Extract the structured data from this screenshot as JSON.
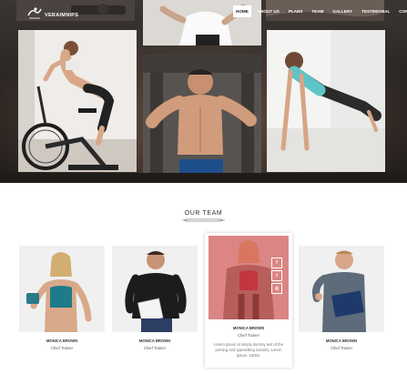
{
  "nav": {
    "logo_text": "VERAIMNIPS",
    "menu": [
      {
        "label": "Home",
        "active": true
      },
      {
        "label": "About Us",
        "active": false
      },
      {
        "label": "Plans",
        "active": false
      },
      {
        "label": "Team",
        "active": false
      },
      {
        "label": "Gallery",
        "active": false
      },
      {
        "label": "Testimonial",
        "active": false
      },
      {
        "label": "Contact",
        "active": false
      }
    ]
  },
  "team": {
    "title": "OUR TEAM",
    "members": [
      {
        "name": "MONICA BROWN",
        "role": "Chief Trainer"
      },
      {
        "name": "MONICA BROWN",
        "role": "Chief Trainer"
      },
      {
        "name": "MONICA BROWN",
        "role": "Chief Trainer",
        "desc": "Lorem Ipsum is simply dummy text of the printing and typesetting industry. Lorem Ipsum. 1500s."
      },
      {
        "name": "MONICA BROWN",
        "role": "Chief Trainer"
      }
    ],
    "social_icons": [
      "facebook-icon",
      "twitter-icon",
      "instagram-icon"
    ]
  },
  "colors": {
    "accent": "#e67b7b",
    "hero_dark": "#2a2522"
  }
}
